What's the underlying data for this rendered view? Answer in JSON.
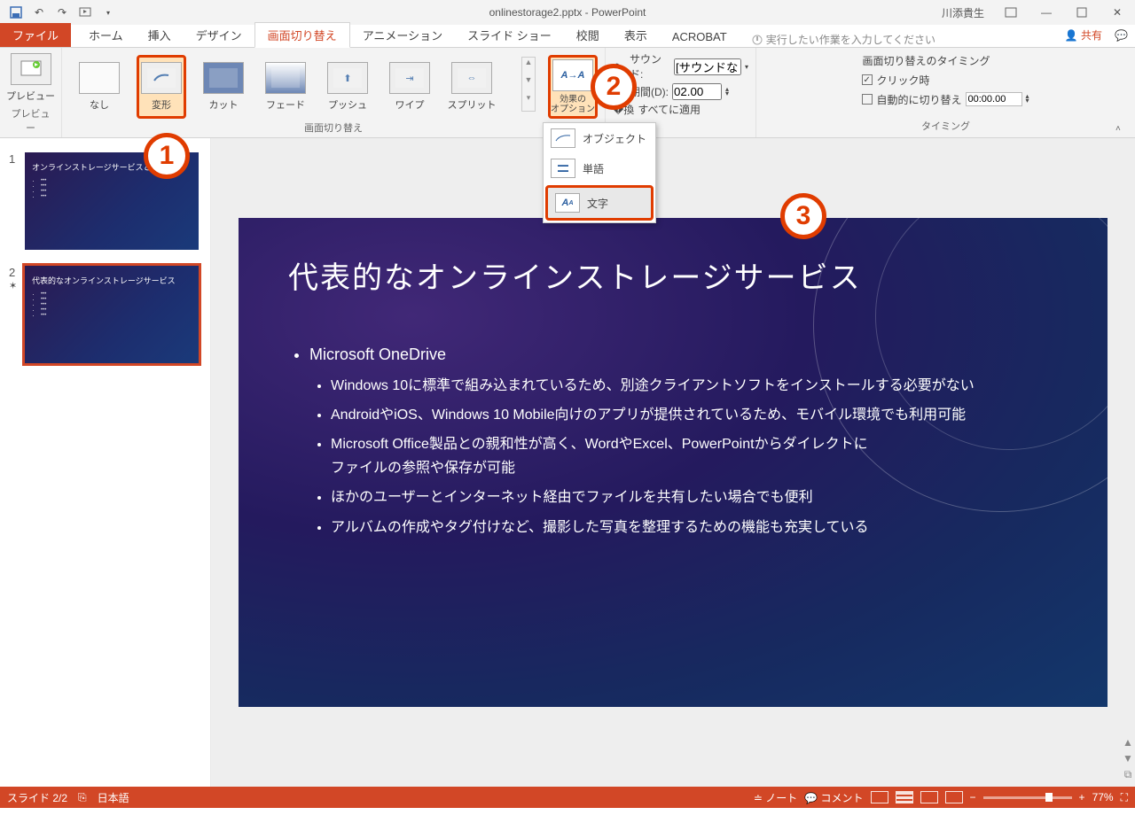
{
  "app": {
    "title": "onlinestorage2.pptx - PowerPoint",
    "user": "川添貴生"
  },
  "tabs": {
    "file": "ファイル",
    "home": "ホーム",
    "insert": "挿入",
    "design": "デザイン",
    "transitions": "画面切り替え",
    "animations": "アニメーション",
    "slideshow": "スライド ショー",
    "review": "校閲",
    "view": "表示",
    "acrobat": "ACROBAT",
    "tell": "実行したい作業を入力してください",
    "share": "共有"
  },
  "ribbon": {
    "preview": "プレビュー",
    "previewGroup": "プレビュー",
    "gallery": {
      "none": "なし",
      "morph": "変形",
      "cut": "カット",
      "fade": "フェード",
      "push": "プッシュ",
      "wipe": "ワイプ",
      "split": "スプリット"
    },
    "galleryGroup": "画面切り替え",
    "effects": "効果の\nオプション",
    "effectsMenu": {
      "object": "オブジェクト",
      "word": "単語",
      "char": "文字"
    },
    "timing": {
      "soundLabel": "サウンド:",
      "soundValue": "[サウンドなし]",
      "durationLabel": "期間(D):",
      "durationValue": "02.00",
      "applyAll": "すべてに適用",
      "heading": "画面切り替えのタイミング",
      "onClick": "クリック時",
      "autoAfter": "自動的に切り替え",
      "autoValue": "00:00.00",
      "group": "タイミング"
    }
  },
  "thumbs": [
    {
      "num": "1",
      "title": "オンラインストレージサービスとは",
      "bullets": [
        "",
        "",
        "",
        ""
      ]
    },
    {
      "num": "2",
      "title": "代表的なオンラインストレージサービス",
      "bullets": [
        "",
        "",
        "",
        "",
        ""
      ]
    }
  ],
  "slide": {
    "title": "代表的なオンラインストレージサービス",
    "h1": "Microsoft OneDrive",
    "items": [
      "Windows 10に標準で組み込まれているため、別途クライアントソフトをインストールする必要がない",
      "AndroidやiOS、Windows 10 Mobile向けのアプリが提供されているため、モバイル環境でも利用可能",
      "Microsoft Office製品との親和性が高く、WordやExcel、PowerPointからダイレクトに\nファイルの参照や保存が可能",
      "ほかのユーザーとインターネット経由でファイルを共有したい場合でも便利",
      "アルバムの作成やタグ付けなど、撮影した写真を整理するための機能も充実している"
    ]
  },
  "status": {
    "slide": "スライド 2/2",
    "lang": "日本語",
    "notes": "ノート",
    "comments": "コメント",
    "zoom": "77%"
  },
  "badges": {
    "b1": "1",
    "b2": "2",
    "b3": "3"
  }
}
